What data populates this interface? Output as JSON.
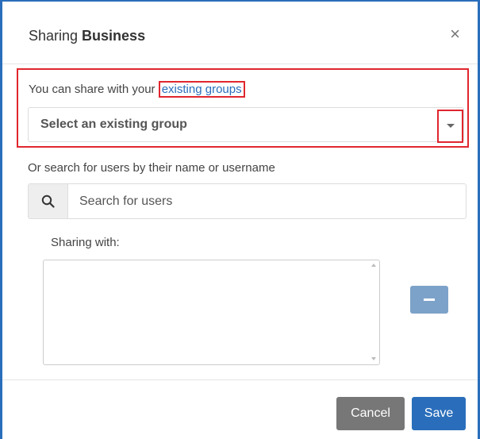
{
  "dialog": {
    "title_prefix": "Sharing ",
    "title_name": "Business",
    "close_label": "×"
  },
  "groups": {
    "prompt": "You can share with your ",
    "link_text": "existing groups",
    "select_value": "Select an existing group"
  },
  "users": {
    "search_label": "Or search for users by their name or username",
    "search_placeholder": "Search for users"
  },
  "sharing": {
    "label": "Sharing with:",
    "items": []
  },
  "footer": {
    "cancel_label": "Cancel",
    "save_label": "Save"
  },
  "colors": {
    "primary": "#2a6ebb",
    "highlight": "#e0262e",
    "cancel": "#777777",
    "remove_button": "#7da2c9"
  },
  "icons": {
    "search": "search-icon",
    "dropdown": "chevron-down-icon",
    "remove": "minus-icon",
    "close": "close-icon"
  }
}
